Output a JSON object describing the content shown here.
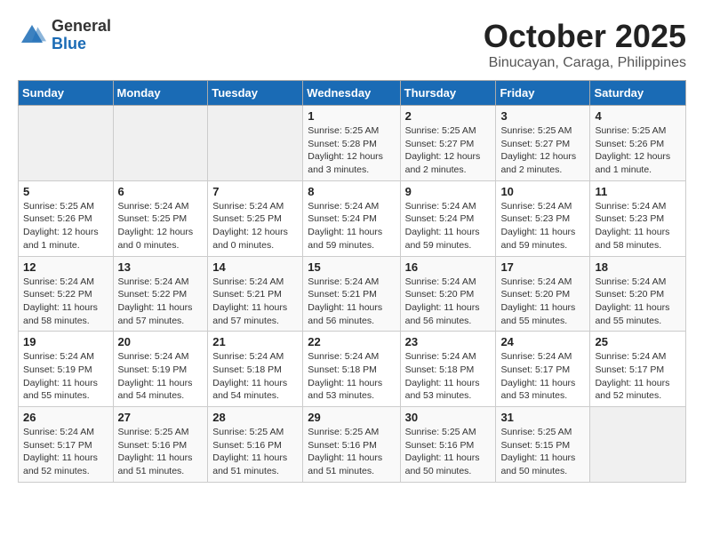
{
  "logo": {
    "general": "General",
    "blue": "Blue"
  },
  "title": "October 2025",
  "subtitle": "Binucayan, Caraga, Philippines",
  "weekdays": [
    "Sunday",
    "Monday",
    "Tuesday",
    "Wednesday",
    "Thursday",
    "Friday",
    "Saturday"
  ],
  "weeks": [
    [
      {
        "day": "",
        "info": ""
      },
      {
        "day": "",
        "info": ""
      },
      {
        "day": "",
        "info": ""
      },
      {
        "day": "1",
        "info": "Sunrise: 5:25 AM\nSunset: 5:28 PM\nDaylight: 12 hours\nand 3 minutes."
      },
      {
        "day": "2",
        "info": "Sunrise: 5:25 AM\nSunset: 5:27 PM\nDaylight: 12 hours\nand 2 minutes."
      },
      {
        "day": "3",
        "info": "Sunrise: 5:25 AM\nSunset: 5:27 PM\nDaylight: 12 hours\nand 2 minutes."
      },
      {
        "day": "4",
        "info": "Sunrise: 5:25 AM\nSunset: 5:26 PM\nDaylight: 12 hours\nand 1 minute."
      }
    ],
    [
      {
        "day": "5",
        "info": "Sunrise: 5:25 AM\nSunset: 5:26 PM\nDaylight: 12 hours\nand 1 minute."
      },
      {
        "day": "6",
        "info": "Sunrise: 5:24 AM\nSunset: 5:25 PM\nDaylight: 12 hours\nand 0 minutes."
      },
      {
        "day": "7",
        "info": "Sunrise: 5:24 AM\nSunset: 5:25 PM\nDaylight: 12 hours\nand 0 minutes."
      },
      {
        "day": "8",
        "info": "Sunrise: 5:24 AM\nSunset: 5:24 PM\nDaylight: 11 hours\nand 59 minutes."
      },
      {
        "day": "9",
        "info": "Sunrise: 5:24 AM\nSunset: 5:24 PM\nDaylight: 11 hours\nand 59 minutes."
      },
      {
        "day": "10",
        "info": "Sunrise: 5:24 AM\nSunset: 5:23 PM\nDaylight: 11 hours\nand 59 minutes."
      },
      {
        "day": "11",
        "info": "Sunrise: 5:24 AM\nSunset: 5:23 PM\nDaylight: 11 hours\nand 58 minutes."
      }
    ],
    [
      {
        "day": "12",
        "info": "Sunrise: 5:24 AM\nSunset: 5:22 PM\nDaylight: 11 hours\nand 58 minutes."
      },
      {
        "day": "13",
        "info": "Sunrise: 5:24 AM\nSunset: 5:22 PM\nDaylight: 11 hours\nand 57 minutes."
      },
      {
        "day": "14",
        "info": "Sunrise: 5:24 AM\nSunset: 5:21 PM\nDaylight: 11 hours\nand 57 minutes."
      },
      {
        "day": "15",
        "info": "Sunrise: 5:24 AM\nSunset: 5:21 PM\nDaylight: 11 hours\nand 56 minutes."
      },
      {
        "day": "16",
        "info": "Sunrise: 5:24 AM\nSunset: 5:20 PM\nDaylight: 11 hours\nand 56 minutes."
      },
      {
        "day": "17",
        "info": "Sunrise: 5:24 AM\nSunset: 5:20 PM\nDaylight: 11 hours\nand 55 minutes."
      },
      {
        "day": "18",
        "info": "Sunrise: 5:24 AM\nSunset: 5:20 PM\nDaylight: 11 hours\nand 55 minutes."
      }
    ],
    [
      {
        "day": "19",
        "info": "Sunrise: 5:24 AM\nSunset: 5:19 PM\nDaylight: 11 hours\nand 55 minutes."
      },
      {
        "day": "20",
        "info": "Sunrise: 5:24 AM\nSunset: 5:19 PM\nDaylight: 11 hours\nand 54 minutes."
      },
      {
        "day": "21",
        "info": "Sunrise: 5:24 AM\nSunset: 5:18 PM\nDaylight: 11 hours\nand 54 minutes."
      },
      {
        "day": "22",
        "info": "Sunrise: 5:24 AM\nSunset: 5:18 PM\nDaylight: 11 hours\nand 53 minutes."
      },
      {
        "day": "23",
        "info": "Sunrise: 5:24 AM\nSunset: 5:18 PM\nDaylight: 11 hours\nand 53 minutes."
      },
      {
        "day": "24",
        "info": "Sunrise: 5:24 AM\nSunset: 5:17 PM\nDaylight: 11 hours\nand 53 minutes."
      },
      {
        "day": "25",
        "info": "Sunrise: 5:24 AM\nSunset: 5:17 PM\nDaylight: 11 hours\nand 52 minutes."
      }
    ],
    [
      {
        "day": "26",
        "info": "Sunrise: 5:24 AM\nSunset: 5:17 PM\nDaylight: 11 hours\nand 52 minutes."
      },
      {
        "day": "27",
        "info": "Sunrise: 5:25 AM\nSunset: 5:16 PM\nDaylight: 11 hours\nand 51 minutes."
      },
      {
        "day": "28",
        "info": "Sunrise: 5:25 AM\nSunset: 5:16 PM\nDaylight: 11 hours\nand 51 minutes."
      },
      {
        "day": "29",
        "info": "Sunrise: 5:25 AM\nSunset: 5:16 PM\nDaylight: 11 hours\nand 51 minutes."
      },
      {
        "day": "30",
        "info": "Sunrise: 5:25 AM\nSunset: 5:16 PM\nDaylight: 11 hours\nand 50 minutes."
      },
      {
        "day": "31",
        "info": "Sunrise: 5:25 AM\nSunset: 5:15 PM\nDaylight: 11 hours\nand 50 minutes."
      },
      {
        "day": "",
        "info": ""
      }
    ]
  ]
}
